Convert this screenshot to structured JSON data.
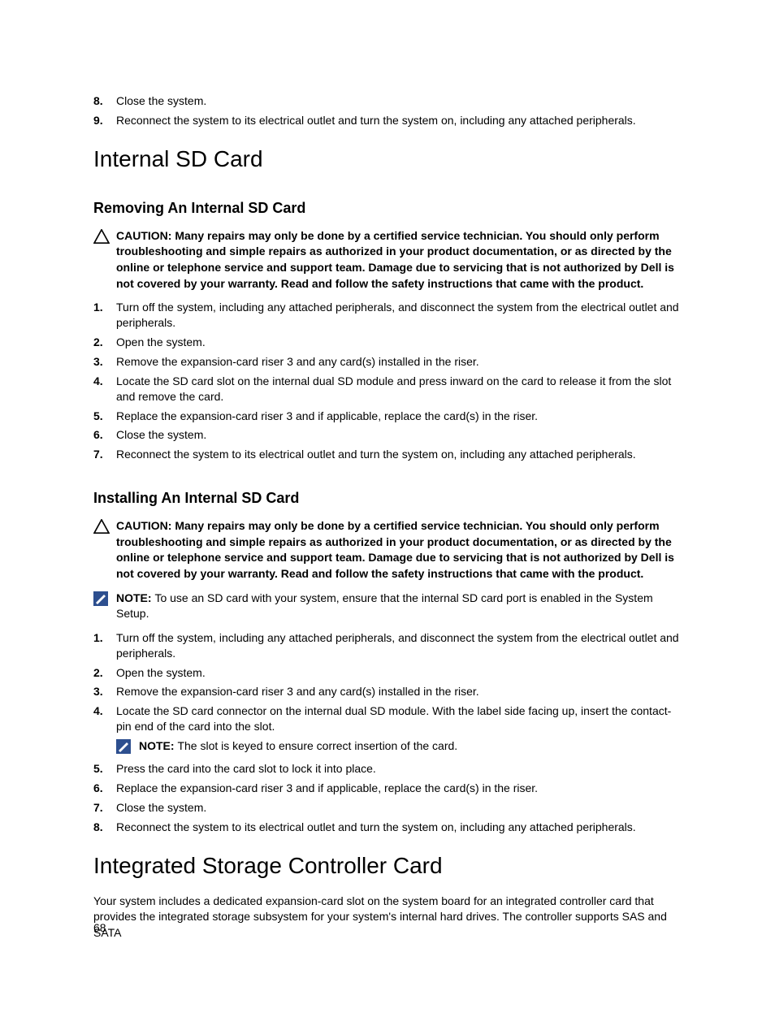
{
  "top_steps": [
    {
      "n": "8.",
      "text": "Close the system."
    },
    {
      "n": "9.",
      "text": "Reconnect the system to its electrical outlet and turn the system on, including any attached peripherals."
    }
  ],
  "h1_sd": "Internal SD Card",
  "removing": {
    "title": "Removing An Internal SD Card",
    "caution_label": "CAUTION: ",
    "caution_text": "Many repairs may only be done by a certified service technician. You should only perform troubleshooting and simple repairs as authorized in your product documentation, or as directed by the online or telephone service and support team. Damage due to servicing that is not authorized by Dell is not covered by your warranty. Read and follow the safety instructions that came with the product.",
    "steps": [
      {
        "n": "1.",
        "text": "Turn off the system, including any attached peripherals, and disconnect the system from the electrical outlet and peripherals."
      },
      {
        "n": "2.",
        "text": "Open the system."
      },
      {
        "n": "3.",
        "text": "Remove the expansion-card riser 3 and any card(s) installed in the riser."
      },
      {
        "n": "4.",
        "text": "Locate the SD card slot on the internal dual SD module and press inward on the card to release it from the slot and remove the card."
      },
      {
        "n": "5.",
        "text": "Replace the expansion-card riser 3 and if applicable, replace the card(s) in the riser."
      },
      {
        "n": "6.",
        "text": "Close the system."
      },
      {
        "n": "7.",
        "text": "Reconnect the system to its electrical outlet and turn the system on, including any attached peripherals."
      }
    ]
  },
  "installing": {
    "title": "Installing An Internal SD Card",
    "caution_label": "CAUTION: ",
    "caution_text": "Many repairs may only be done by a certified service technician. You should only perform troubleshooting and simple repairs as authorized in your product documentation, or as directed by the online or telephone service and support team. Damage due to servicing that is not authorized by Dell is not covered by your warranty. Read and follow the safety instructions that came with the product.",
    "note1_label": "NOTE: ",
    "note1_text": "To use an SD card with your system, ensure that the internal SD card port is enabled in the System Setup.",
    "steps_a": [
      {
        "n": "1.",
        "text": "Turn off the system, including any attached peripherals, and disconnect the system from the electrical outlet and peripherals."
      },
      {
        "n": "2.",
        "text": "Open the system."
      },
      {
        "n": "3.",
        "text": "Remove the expansion-card riser 3 and any card(s) installed in the riser."
      },
      {
        "n": "4.",
        "text": "Locate the SD card connector on the internal dual SD module. With the label side facing up, insert the contact-pin end of the card into the slot."
      }
    ],
    "note2_label": "NOTE: ",
    "note2_text": "The slot is keyed to ensure correct insertion of the card.",
    "steps_b": [
      {
        "n": "5.",
        "text": "Press the card into the card slot to lock it into place."
      },
      {
        "n": "6.",
        "text": "Replace the expansion-card riser 3 and if applicable, replace the card(s) in the riser."
      },
      {
        "n": "7.",
        "text": "Close the system."
      },
      {
        "n": "8.",
        "text": "Reconnect the system to its electrical outlet and turn the system on, including any attached peripherals."
      }
    ]
  },
  "h1_controller": "Integrated Storage Controller Card",
  "controller_p": "Your system includes a dedicated expansion-card slot on the system board for an integrated controller card that provides the integrated storage subsystem for your system's internal hard drives. The controller supports SAS and SATA",
  "page_number": "68"
}
